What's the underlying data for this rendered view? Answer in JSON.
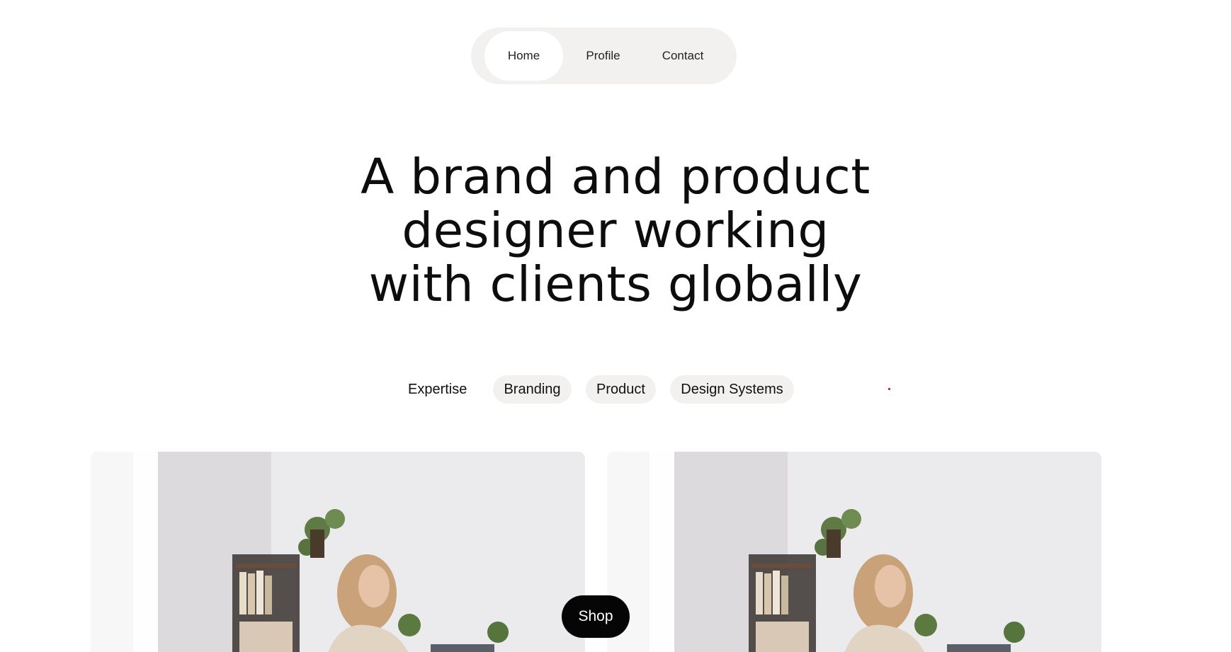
{
  "nav": {
    "items": [
      {
        "label": "Home",
        "active": true
      },
      {
        "label": "Profile",
        "active": false
      },
      {
        "label": "Contact",
        "active": false
      }
    ]
  },
  "hero": {
    "lines": [
      "A brand and product",
      "designer working",
      "with clients globally"
    ]
  },
  "expertise": {
    "label": "Expertise",
    "tags": [
      "Branding",
      "Product",
      "Design Systems"
    ]
  },
  "shop_button": {
    "label": "Shop"
  },
  "colors": {
    "background": "#ffffff",
    "pill": "#f2f1ef",
    "text": "#111111",
    "button": "#050505",
    "accent_dot": "#d0021b"
  }
}
